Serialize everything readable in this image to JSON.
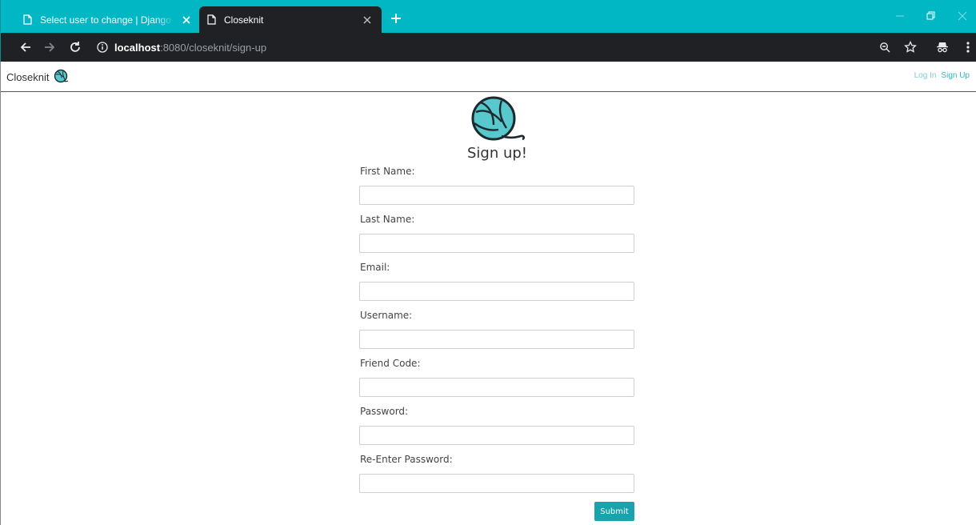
{
  "browser": {
    "tabs": [
      {
        "title": "Select user to change | Django site admin",
        "active": false
      },
      {
        "title": "Closeknit",
        "active": true
      }
    ],
    "url_host": "localhost",
    "url_path": ":8080/closeknit/sign-up",
    "accent_color": "#00b7c3"
  },
  "site": {
    "brand": "Closeknit",
    "nav": {
      "login": "Log In",
      "signup": "Sign Up"
    },
    "link_color": "#31b5c0"
  },
  "form": {
    "title": "Sign up!",
    "fields": [
      {
        "label": "First Name:",
        "value": ""
      },
      {
        "label": "Last Name:",
        "value": ""
      },
      {
        "label": "Email:",
        "value": ""
      },
      {
        "label": "Username:",
        "value": ""
      },
      {
        "label": "Friend Code:",
        "value": ""
      },
      {
        "label": "Password:",
        "value": ""
      },
      {
        "label": "Re-Enter Password:",
        "value": ""
      }
    ],
    "submit_label": "Submit",
    "button_color": "#18a3ad"
  },
  "icons": {
    "tab_page": "page-icon",
    "close": "close-icon",
    "new_tab": "plus-icon",
    "back": "back-arrow-icon",
    "forward": "forward-arrow-icon",
    "reload": "reload-icon",
    "site_info": "info-icon",
    "zoom": "zoom-icon",
    "bookmark": "star-icon",
    "incognito": "incognito-icon",
    "menu": "kebab-menu-icon",
    "logo": "yarn-ball-icon"
  }
}
